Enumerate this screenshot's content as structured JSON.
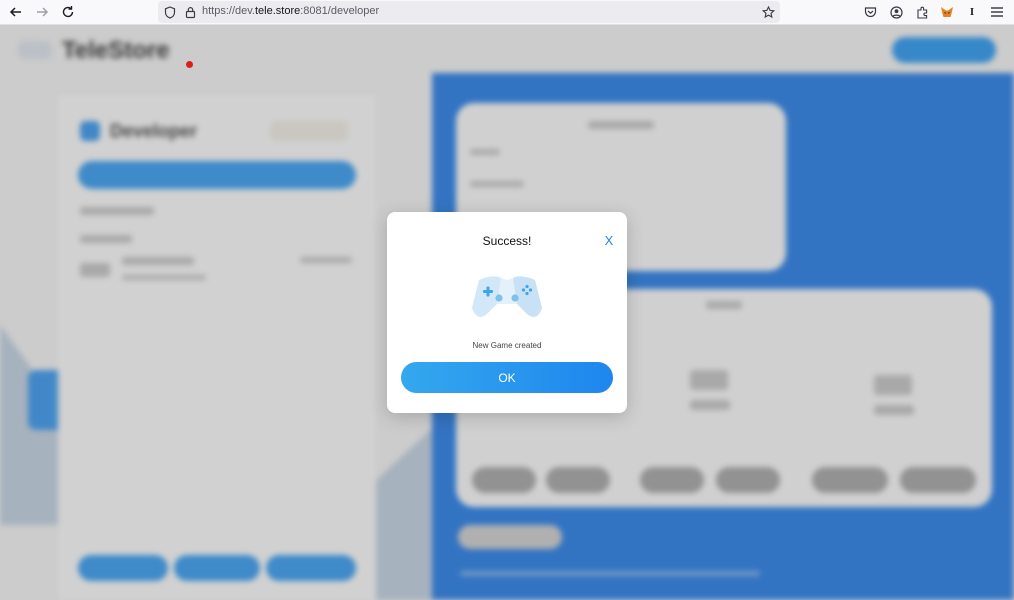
{
  "browser": {
    "url_prefix": "https://dev.",
    "url_host": "tele.store",
    "url_suffix": ":8081/developer",
    "ext_letter": "I",
    "icons": [
      "back-arrow-icon",
      "forward-arrow-icon",
      "reload-icon",
      "shield-icon",
      "lock-icon",
      "bookmark-star-icon",
      "pocket-icon",
      "account-icon",
      "extensions-icon",
      "metamask-fox-icon",
      "menu-icon"
    ]
  },
  "background": {
    "logo": "TeleStore",
    "section_title": "Developer"
  },
  "modal": {
    "title": "Success!",
    "close_symbol": "X",
    "icon": "gamepad-icon",
    "message": "New Game created",
    "ok_label": "OK"
  },
  "colors": {
    "accent": "#1e86ee",
    "panel_blue": "#1a73e0",
    "close_blue": "#1e88e5"
  }
}
